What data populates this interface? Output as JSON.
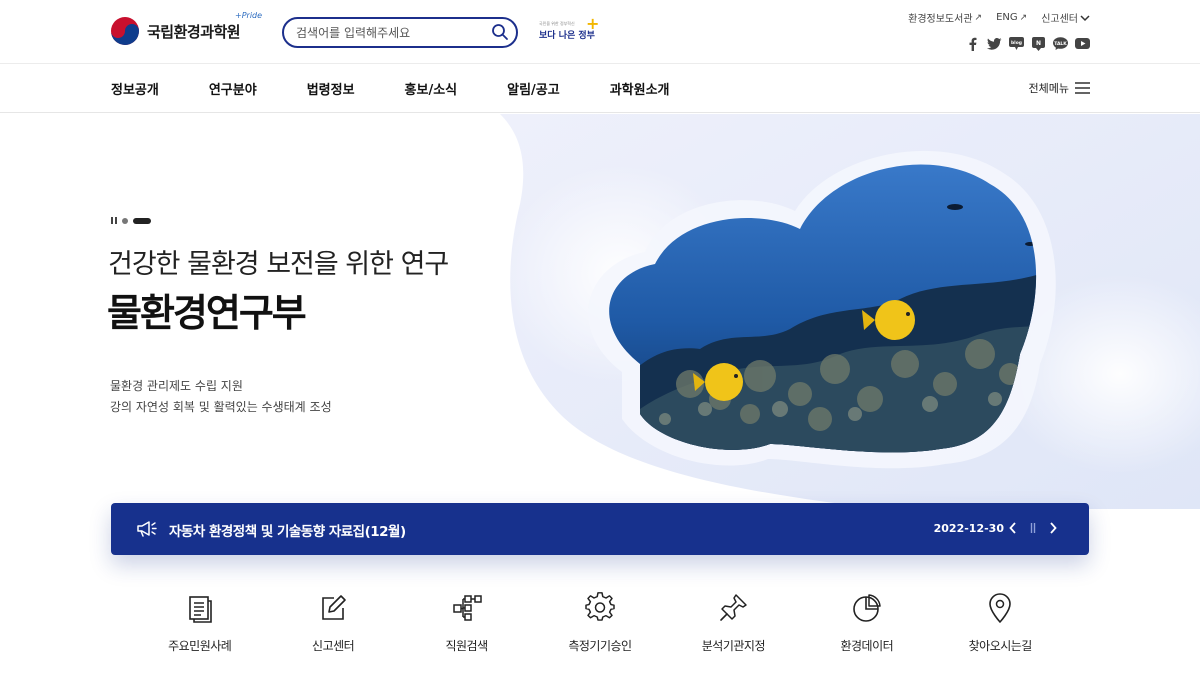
{
  "header": {
    "logo_text": "국립환경과학원",
    "logo_pride": "+Pride",
    "search_placeholder": "검색어를 입력해주세요",
    "slogan_small": "국민을 위한 정부혁신",
    "slogan_main": "보다 나은 정부",
    "util_links": [
      {
        "label": "환경정보도서관",
        "icon": "external-arrow-icon"
      },
      {
        "label": "ENG",
        "icon": "external-arrow-icon"
      },
      {
        "label": "신고센터",
        "icon": "chevron-down-icon"
      }
    ],
    "sns": [
      "facebook-icon",
      "twitter-icon",
      "blog-icon",
      "post-icon",
      "kakaotalk-icon",
      "youtube-icon"
    ]
  },
  "gnb": {
    "items": [
      "정보공개",
      "연구분야",
      "법령정보",
      "홍보/소식",
      "알림/공고",
      "과학원소개"
    ],
    "all_menu_label": "전체메뉴"
  },
  "hero": {
    "subtitle": "건강한 물환경 보전을 위한 연구",
    "title": "물환경연구부",
    "desc_line1": "물환경 관리제도 수립 지원",
    "desc_line2": "강의 자연성 회복 및 활력있는 수생태계 조성",
    "slide_count": 3,
    "active_slide": 3
  },
  "notice": {
    "title": "자동차 환경정책 및 기술동향 자료집(12월)",
    "date": "2022-12-30"
  },
  "quick_menu": [
    {
      "label": "주요민원사례",
      "icon": "document-list-icon"
    },
    {
      "label": "신고센터",
      "icon": "edit-icon"
    },
    {
      "label": "직원검색",
      "icon": "org-chart-icon"
    },
    {
      "label": "측정기기승인",
      "icon": "gear-icon"
    },
    {
      "label": "분석기관지정",
      "icon": "pin-icon"
    },
    {
      "label": "환경데이터",
      "icon": "pie-chart-icon"
    },
    {
      "label": "찾아오시는길",
      "icon": "location-icon"
    }
  ],
  "colors": {
    "primary_navy": "#17318d",
    "accent_yellow": "#f2b600"
  }
}
